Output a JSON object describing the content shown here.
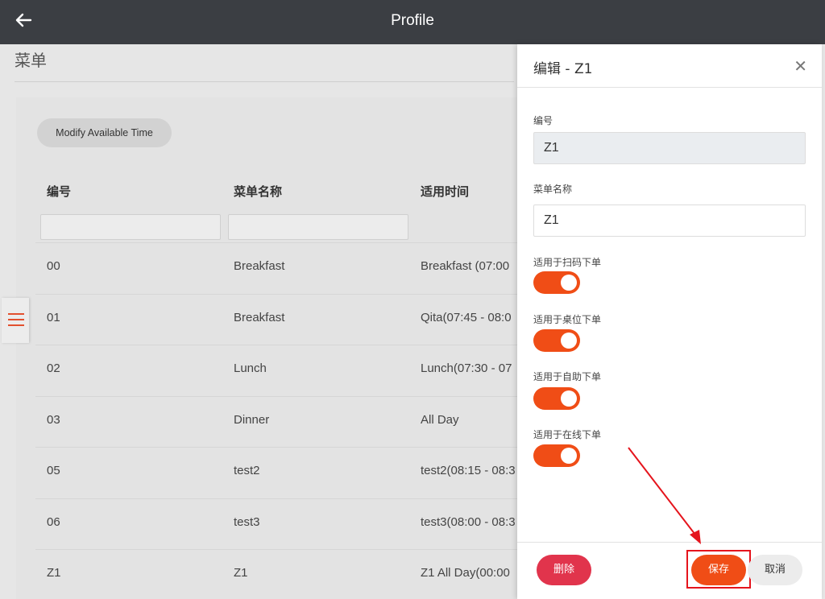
{
  "header": {
    "back_icon": "arrow-left-icon",
    "title": "Profile"
  },
  "page": {
    "title": "菜单"
  },
  "toolbar": {
    "modify_time_label": "Modify Available Time"
  },
  "table": {
    "columns": [
      "编号",
      "菜单名称",
      "适用时间"
    ],
    "rows": [
      {
        "code": "00",
        "name": "Breakfast",
        "time": "Breakfast (07:00"
      },
      {
        "code": "01",
        "name": "Breakfast",
        "time": "Qita(07:45 - 08:0"
      },
      {
        "code": "02",
        "name": "Lunch",
        "time": "Lunch(07:30 - 07"
      },
      {
        "code": "03",
        "name": "Dinner",
        "time": "All Day"
      },
      {
        "code": "05",
        "name": "test2",
        "time": "test2(08:15 - 08:3"
      },
      {
        "code": "06",
        "name": "test3",
        "time": "test3(08:00 - 08:3"
      },
      {
        "code": "Z1",
        "name": "Z1",
        "time": "Z1 All Day(00:00"
      }
    ]
  },
  "sidebar_toggle": {
    "icon": "menu-icon"
  },
  "dialog": {
    "title": "编辑 - Z1",
    "close_icon": "close-icon",
    "code_label": "编号",
    "code_value": "Z1",
    "name_label": "菜单名称",
    "name_value": "Z1",
    "toggles": [
      {
        "label": "适用于扫码下单",
        "on": true
      },
      {
        "label": "适用于桌位下单",
        "on": true
      },
      {
        "label": "适用于自助下单",
        "on": true
      },
      {
        "label": "适用于在线下单",
        "on": true
      }
    ],
    "delete_label": "删除",
    "save_label": "保存",
    "cancel_label": "取消"
  },
  "colors": {
    "accent": "#f04d16",
    "danger": "#e1344c",
    "header": "#3b3e43",
    "annotation": "#e5141c"
  }
}
